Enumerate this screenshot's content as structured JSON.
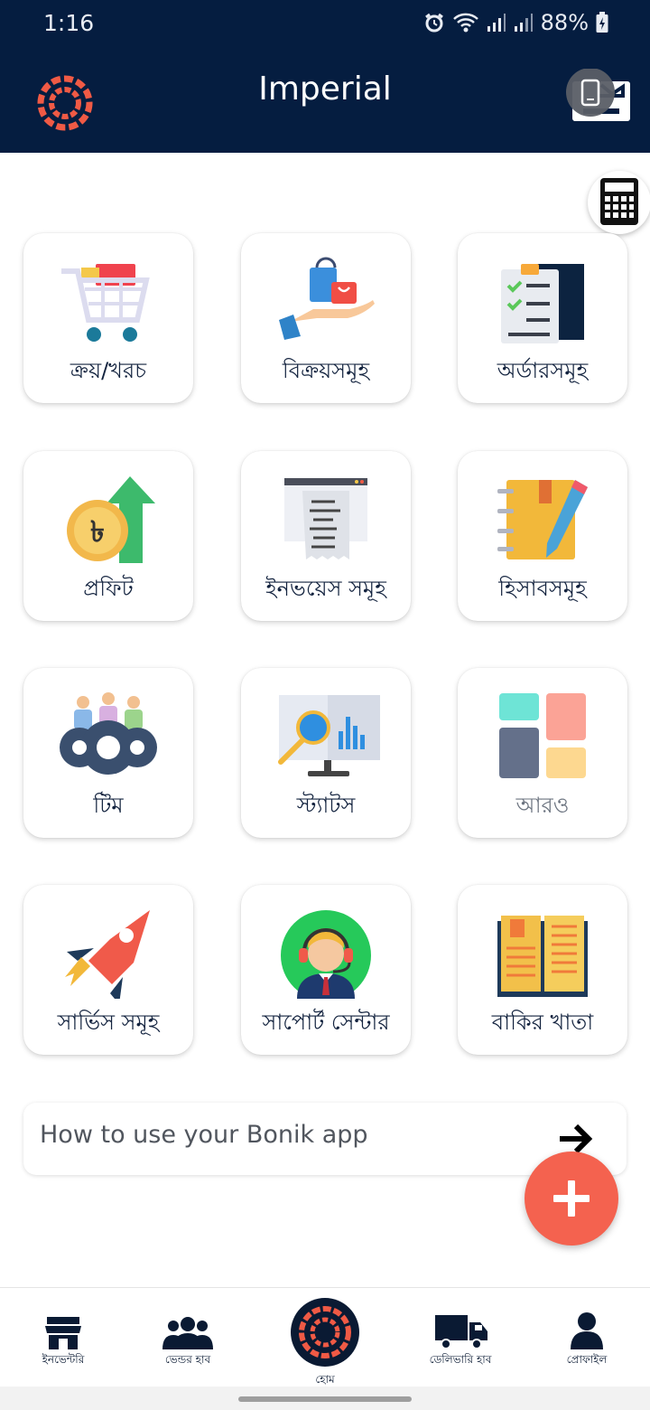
{
  "status": {
    "time": "1:16",
    "battery": "88%"
  },
  "app": {
    "title": "Imperial"
  },
  "grid": [
    {
      "label": "ক্রয়/খরচ",
      "icon": "shopping-cart-icon"
    },
    {
      "label": "বিক্রয়সমূহ",
      "icon": "hand-shopping-bags-icon"
    },
    {
      "label": "অর্ডারসমূহ",
      "icon": "checklist-clipboard-icon"
    },
    {
      "label": "প্রফিট",
      "icon": "taka-coin-up-arrow-icon"
    },
    {
      "label": "ইনভয়েস সমূহ",
      "icon": "printer-receipt-icon"
    },
    {
      "label": "হিসাবসমূহ",
      "icon": "notebook-pencil-icon"
    },
    {
      "label": "টিম",
      "icon": "team-gears-icon"
    },
    {
      "label": "স্ট্যাটস",
      "icon": "stats-monitor-icon"
    },
    {
      "label": "আরও",
      "icon": "more-tiles-icon"
    },
    {
      "label": "সার্ভিস সমূহ",
      "icon": "rocket-icon"
    },
    {
      "label": "সাপোর্ট সেন্টার",
      "icon": "support-agent-icon"
    },
    {
      "label": "বাকির খাতা",
      "icon": "open-ledger-icon"
    }
  ],
  "howto": {
    "text": "How to use your Bonik app"
  },
  "nav": [
    {
      "label": "ইনভেন্টরি",
      "icon": "store-icon"
    },
    {
      "label": "ভেন্ডর হাব",
      "icon": "people-group-icon"
    },
    {
      "label": "হোম",
      "icon": "home-logo-icon"
    },
    {
      "label": "ডেলিভারি হাব",
      "icon": "delivery-truck-icon"
    },
    {
      "label": "প্রোফাইল",
      "icon": "profile-icon"
    }
  ],
  "colors": {
    "navy": "#051d40",
    "accent": "#f4624f",
    "logo": "#f05a45"
  }
}
